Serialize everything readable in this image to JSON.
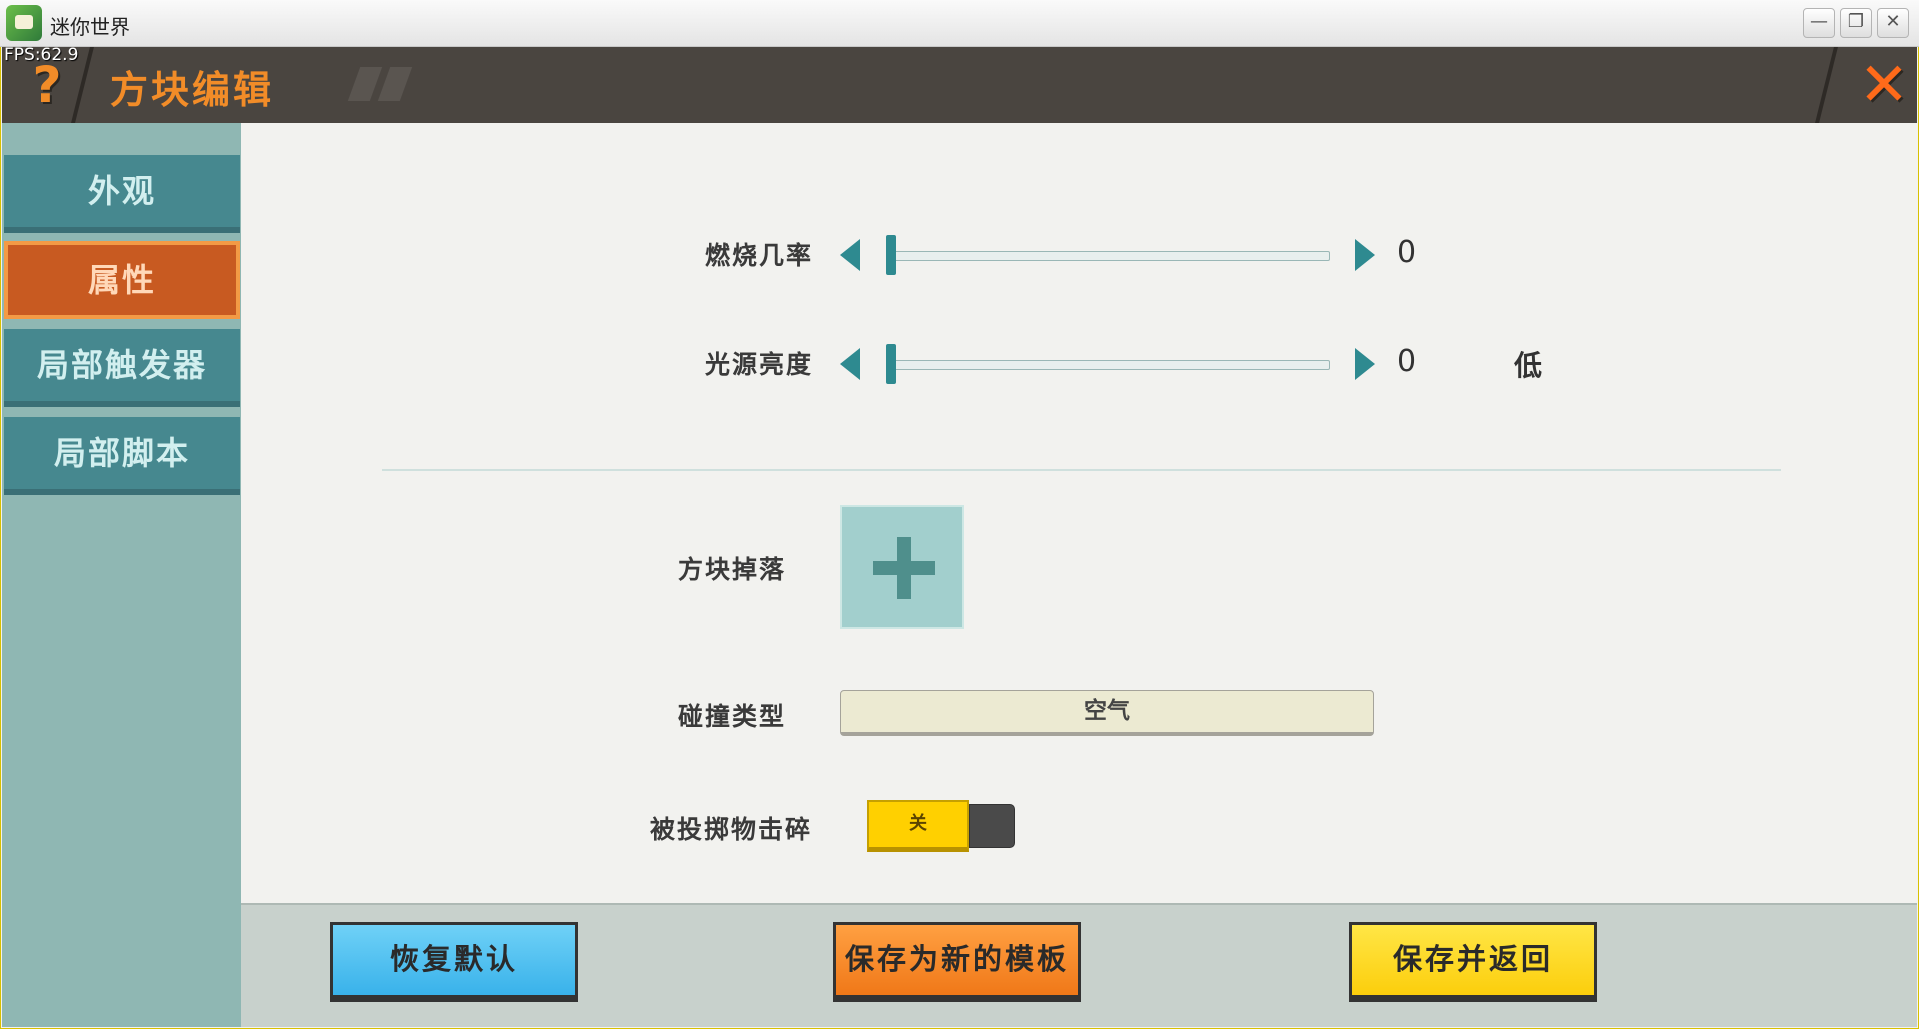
{
  "window": {
    "title": "迷你世界",
    "minimize_glyph": "—",
    "restore_glyph": "❐",
    "close_glyph": "✕"
  },
  "fps": "FPS:62.9",
  "header": {
    "help_glyph": "?",
    "title": "方块编辑",
    "close_glyph": "✕"
  },
  "sidebar": {
    "items": [
      {
        "label": "外观",
        "active": false
      },
      {
        "label": "属性",
        "active": true
      },
      {
        "label": "局部触发器",
        "active": false
      },
      {
        "label": "局部脚本",
        "active": false
      }
    ]
  },
  "properties": {
    "burn_rate": {
      "label": "燃烧几率",
      "value": "0",
      "fraction": 0.0
    },
    "light_level": {
      "label": "光源亮度",
      "value": "0",
      "fraction": 0.0,
      "level_text": "低"
    },
    "block_drop": {
      "label": "方块掉落"
    },
    "collision_type": {
      "label": "碰撞类型",
      "value": "空气"
    },
    "projectile_break": {
      "label": "被投掷物击碎",
      "state": "关"
    }
  },
  "buttons": {
    "reset": "恢复默认",
    "save_template": "保存为新的模板",
    "save_return": "保存并返回"
  },
  "colors": {
    "accent_orange": "#f28c28",
    "teal": "#2e8a90",
    "header_bg": "#4a4540"
  }
}
